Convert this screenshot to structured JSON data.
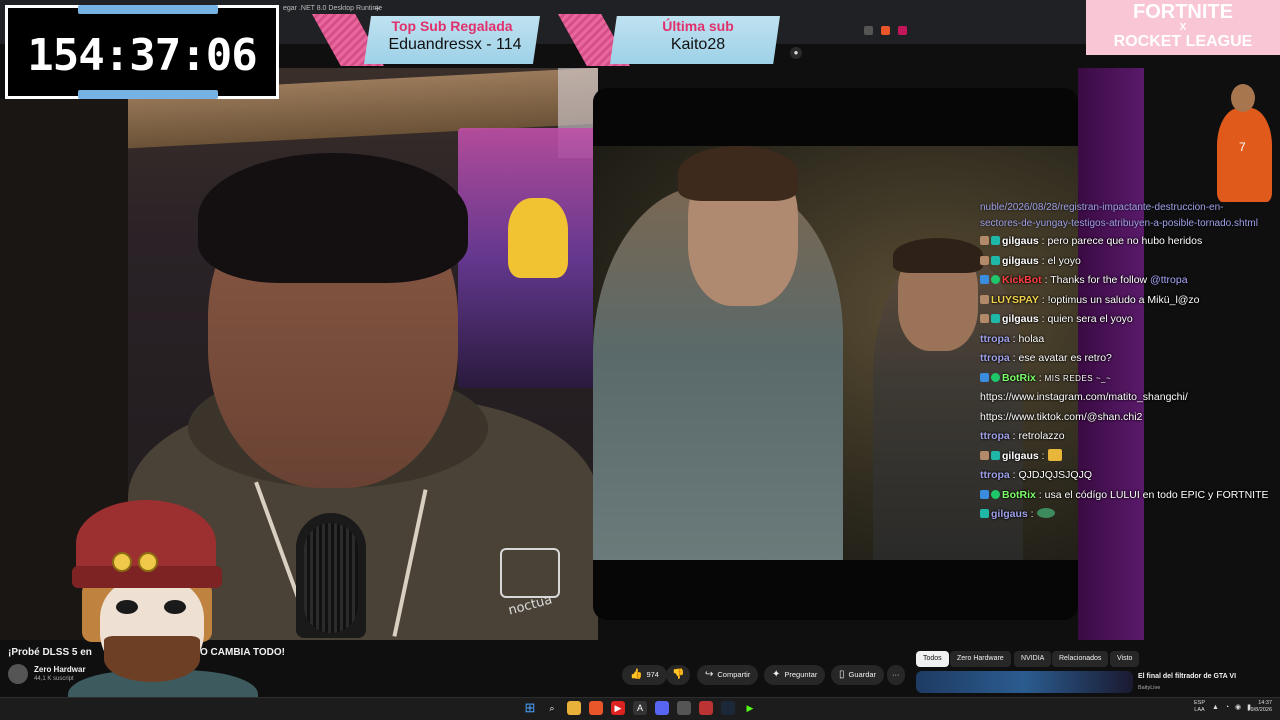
{
  "browser": {
    "tab_text": "egar .NET 8.0 Desktop Runtime",
    "plus": "+",
    "mic_icon": "mic-icon"
  },
  "timer": {
    "value": "154:37:06"
  },
  "banners": {
    "top_sub": {
      "label": "Top Sub Regalada",
      "value": "Eduandressx - 114"
    },
    "last_sub": {
      "label": "Última sub",
      "value": "Kaito28"
    }
  },
  "fortnite": {
    "line1": "FORTNITE",
    "line2": "X",
    "line3": "ROCKET LEAGUE"
  },
  "chat": {
    "url_head": "nuble/2026/08/28/registran-impactante-destruccion-en-sectores-de-yungay-testigos-atribuyen-a-posible-tornado.shtml",
    "messages": [
      {
        "user": "gilgaus",
        "color": "#ffffff",
        "badges": [
          "a",
          "b"
        ],
        "text": "pero parece que no hubo heridos"
      },
      {
        "user": "gilgaus",
        "color": "#ffffff",
        "badges": [
          "a",
          "b"
        ],
        "text": "el yoyo"
      },
      {
        "user": "KickBot",
        "color": "#ff4040",
        "badges": [
          "c",
          "d"
        ],
        "text": "Thanks for the follow ",
        "mention": "@ttropa"
      },
      {
        "user": "LUYSPAY",
        "color": "#f0d24a",
        "badges": [
          "a"
        ],
        "text": "!optimus un saludo a Mikü_l@zo"
      },
      {
        "user": "gilgaus",
        "color": "#ffffff",
        "badges": [
          "a",
          "b"
        ],
        "text": "quien sera el yoyo"
      },
      {
        "user": "ttropa",
        "color": "#9fa0e8",
        "badges": [],
        "text": "holaa"
      },
      {
        "user": "ttropa",
        "color": "#9fa0e8",
        "badges": [],
        "text": "ese avatar es retro?"
      },
      {
        "user": "BotRix",
        "color": "#7dff6a",
        "badges": [
          "c",
          "d"
        ],
        "text": "MIS REDES ~_~",
        "small": true
      },
      {
        "user": "",
        "color": "#ffffff",
        "badges": [],
        "text": "https://www.instagram.com/matito_shangchi/"
      },
      {
        "user": "",
        "color": "#ffffff",
        "badges": [],
        "text": "https://www.tiktok.com/@shan.chi2"
      },
      {
        "user": "ttropa",
        "color": "#9fa0e8",
        "badges": [],
        "text": "retrolazzo"
      },
      {
        "user": "gilgaus",
        "color": "#ffffff",
        "badges": [
          "a",
          "b"
        ],
        "text": "",
        "emote": "emote-1"
      },
      {
        "user": "ttropa",
        "color": "#9fa0e8",
        "badges": [],
        "text": "QJDJQJSJQJQ"
      },
      {
        "user": "BotRix",
        "color": "#7dff6a",
        "badges": [
          "c",
          "d"
        ],
        "text": "usa el códígo LULUI en todo EPIC y FORTNITE"
      },
      {
        "user": "gilgaus",
        "color": "#9fa0e8",
        "badges": [
          "b"
        ],
        "text": "",
        "emote": "emote-2"
      }
    ]
  },
  "video": {
    "title": "¡Probé DLSS 5 en",
    "title_end": "O CAMBIA TODO!",
    "channel": "Zero Hardwar",
    "subs": "44,1 K suscript",
    "like_count": "974",
    "share": "Compartir",
    "ask": "Preguntar",
    "save": "Guardar",
    "more": "···"
  },
  "chips": [
    "Todos",
    "Zero Hardware",
    "NVIDIA",
    "Relacionados",
    "Visto"
  ],
  "recommended": {
    "title": "El final del filtrador de GTA VI",
    "channel": "BaityLive"
  },
  "taskbar": {
    "lang1": "ESP",
    "lang2": "LAA",
    "time": "14:37",
    "date": "29/8/2026",
    "tray": "▲ ◔ ◉ ▮"
  },
  "colors": {
    "accent_pink": "#e1306c",
    "banner_blue": "#9ed1e7",
    "timer_bar": "#77b2e4"
  }
}
